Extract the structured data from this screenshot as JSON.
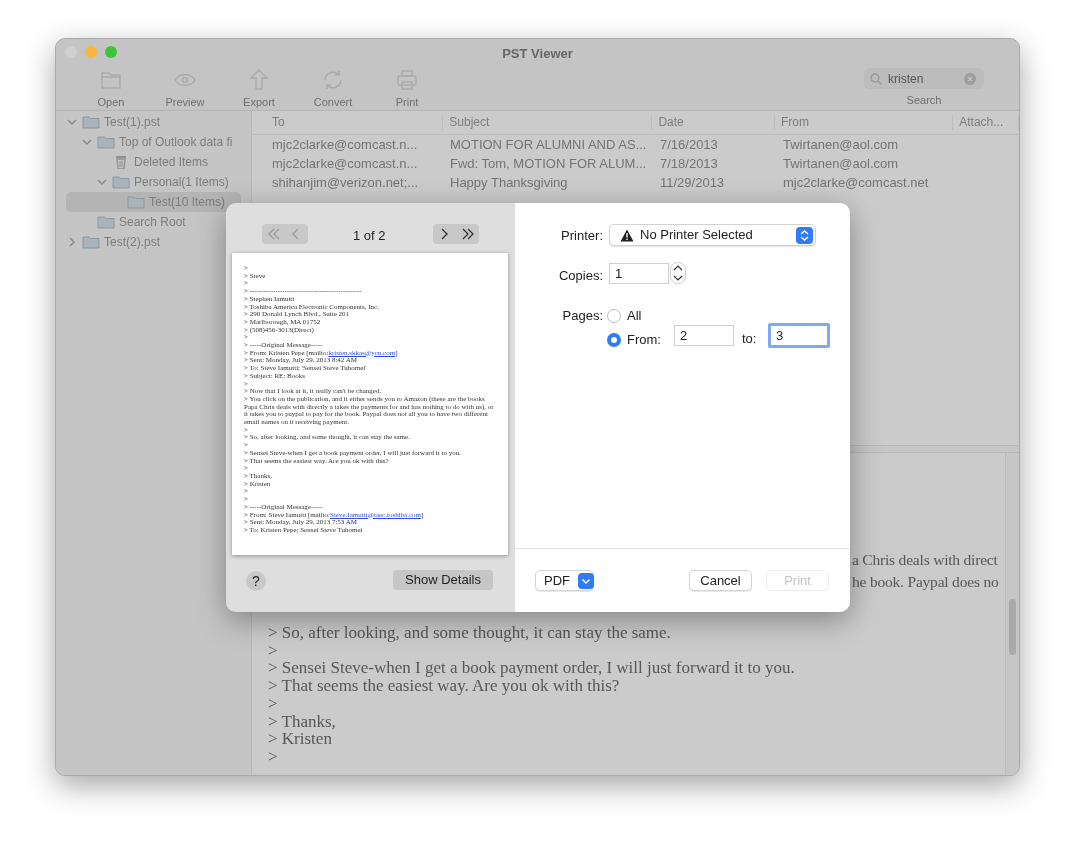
{
  "window": {
    "title": "PST Viewer"
  },
  "toolbar": [
    {
      "label": "Open",
      "kind": "open"
    },
    {
      "label": "Preview",
      "kind": "preview"
    },
    {
      "label": "Export",
      "kind": "export"
    },
    {
      "label": "Convert",
      "kind": "convert"
    },
    {
      "label": "Print",
      "kind": "print"
    }
  ],
  "search": {
    "value": "kristen",
    "label": "Search"
  },
  "sidebar": {
    "tree": [
      {
        "label": "Test(1).pst",
        "kind": "folder",
        "expanded": true,
        "selected": false,
        "children": [
          {
            "label": "Top of Outlook data fi",
            "kind": "folder",
            "expanded": true,
            "selected": false,
            "children": [
              {
                "label": "Deleted Items",
                "kind": "trash",
                "selected": false
              },
              {
                "label": "Personal(1 Items)",
                "kind": "folder",
                "expanded": true,
                "selected": false,
                "children": [
                  {
                    "label": "Test(10 Items)",
                    "kind": "folder",
                    "selected": true
                  }
                ]
              }
            ]
          },
          {
            "label": "Search Root",
            "kind": "folder",
            "selected": false
          }
        ]
      },
      {
        "label": "Test(2).pst",
        "kind": "folder",
        "expanded": false,
        "selected": false
      }
    ]
  },
  "table": {
    "columns": [
      "To",
      "Subject",
      "Date",
      "From",
      "Attach..."
    ],
    "rows": [
      [
        "mjc2clarke@comcast.n...",
        "MOTION FOR ALUMNI AND AS...",
        "7/16/2013",
        "Twirtanen@aol.com"
      ],
      [
        "mjc2clarke@comcast.n...",
        "Fwd: Tom, MOTION FOR ALUM...",
        "7/18/2013",
        "Twirtanen@aol.com"
      ],
      [
        "shihanjim@verizon.net;...",
        "Happy Thanksgiving",
        "11/29/2013",
        "mjc2clarke@comcast.net"
      ]
    ]
  },
  "message": {
    "lines": [
      {
        "kind": "fragment",
        "text": "a Chris deals with direct"
      },
      {
        "kind": "fragment",
        "text": "he book. Paypal does no"
      },
      {
        "kind": "gap"
      },
      {
        "kind": "line",
        "text": "> So, after looking, and some thought, it can stay the same."
      },
      {
        "kind": "line",
        "text": ">"
      },
      {
        "kind": "line",
        "text": "> Sensei Steve-when I get a book payment order, I will just forward it to you."
      },
      {
        "kind": "line",
        "text": "> That seems the easiest way. Are you ok with this?"
      },
      {
        "kind": "line",
        "text": ">"
      },
      {
        "kind": "line",
        "text": "> Thanks,"
      },
      {
        "kind": "line",
        "text": "> Kristen"
      },
      {
        "kind": "line",
        "text": ">"
      }
    ]
  },
  "print_dialog": {
    "page_counter": "1 of 2",
    "nav": [
      {
        "kind": "first",
        "disabled": true
      },
      {
        "kind": "previous",
        "disabled": true
      },
      {
        "kind": "next",
        "disabled": false
      },
      {
        "kind": "last",
        "disabled": false
      }
    ],
    "preview_lines": [
      {
        "text": ">"
      },
      {
        "text": "> Steve"
      },
      {
        "text": ">"
      },
      {
        "text": "> ------------------------------------------------"
      },
      {
        "text": "> Stephen Iamutti"
      },
      {
        "text": "> Toshiba America Electronic Components, Inc."
      },
      {
        "text": "> 290 Donald Lynch Blvd., Suite 201"
      },
      {
        "text": "> Marlborough, MA 01752"
      },
      {
        "text": "> (508)456-3013(Direct)"
      },
      {
        "text": ">"
      },
      {
        "text": "> -----Original Message-----"
      },
      {
        "text": "> From: Kristen Pepe [mailto:",
        "link": "kristen.skkas@ycn.com",
        "after": "]"
      },
      {
        "text": "> Sent: Monday, July 29, 2013 8:42 AM"
      },
      {
        "text": "> To: Steve Iamutti; 'Sensei Steve Tuhomei'"
      },
      {
        "text": "> Subject: RE: Books"
      },
      {
        "text": ">"
      },
      {
        "text": "> Now that I look at it, it really can't be changed."
      },
      {
        "text": "> You click on the publication, and it either sends you to Amazon (these are the books Papa Chris deals with directly a takes the payments for and has nothing to do with us), or it takes you to paypal to pay for the book. Paypal does not all you to have two different email names on it receiving payment."
      },
      {
        "text": ">"
      },
      {
        "text": "> So, after looking, and some thought, it can stay the same."
      },
      {
        "text": ">"
      },
      {
        "text": "> Sensei Steve-when I get a book payment order, I will just forward it to you."
      },
      {
        "text": "> That seems the easiest way. Are you ok with this?"
      },
      {
        "text": ">"
      },
      {
        "text": "> Thanks,"
      },
      {
        "text": "> Kristen"
      },
      {
        "text": ">"
      },
      {
        "text": ">"
      },
      {
        "text": "> -----Original Message-----"
      },
      {
        "text": "> From: Steve Iamutti [mailto:",
        "link": "Steve.Iamutti@taec.toshiba.com",
        "after": "]"
      },
      {
        "text": "> Sent: Monday, July 29, 2013 7:53 AM"
      },
      {
        "text": "> To: Kristen Pepe; Sensei Steve Tuhomei"
      }
    ],
    "help": "?",
    "show_details": "Show Details",
    "printer": {
      "label": "Printer:",
      "value": "No Printer Selected",
      "warning": true
    },
    "copies": {
      "label": "Copies:",
      "value": "1"
    },
    "pages": {
      "label": "Pages:",
      "options": [
        {
          "label": "All",
          "selected": false
        },
        {
          "label": "From:",
          "selected": true
        }
      ],
      "from": {
        "value": "2",
        "focused": false
      },
      "to_label": "to:",
      "to": {
        "value": "3",
        "focused": true
      }
    },
    "pdf": "PDF",
    "buttons": [
      {
        "label": "Cancel",
        "disabled": false
      },
      {
        "label": "Print",
        "disabled": true
      }
    ]
  }
}
